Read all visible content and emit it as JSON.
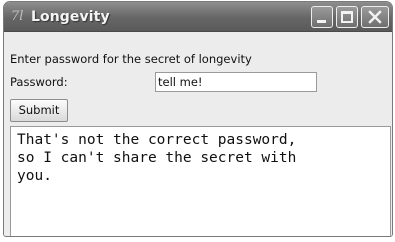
{
  "window": {
    "title": "Longevity",
    "app_icon": "7l",
    "controls": {
      "minimize": "minimize-icon",
      "maximize": "maximize-icon",
      "close": "close-icon"
    }
  },
  "form": {
    "prompt": "Enter password for the secret of longevity",
    "password_label": "Password:",
    "password_value": "tell me!",
    "submit_label": "Submit"
  },
  "output": {
    "text": "That's not the correct password,\nso I can't share the secret with\nyou."
  },
  "colors": {
    "titlebar": "#666666",
    "window_bg": "#ececec",
    "field_bg": "#ffffff"
  }
}
